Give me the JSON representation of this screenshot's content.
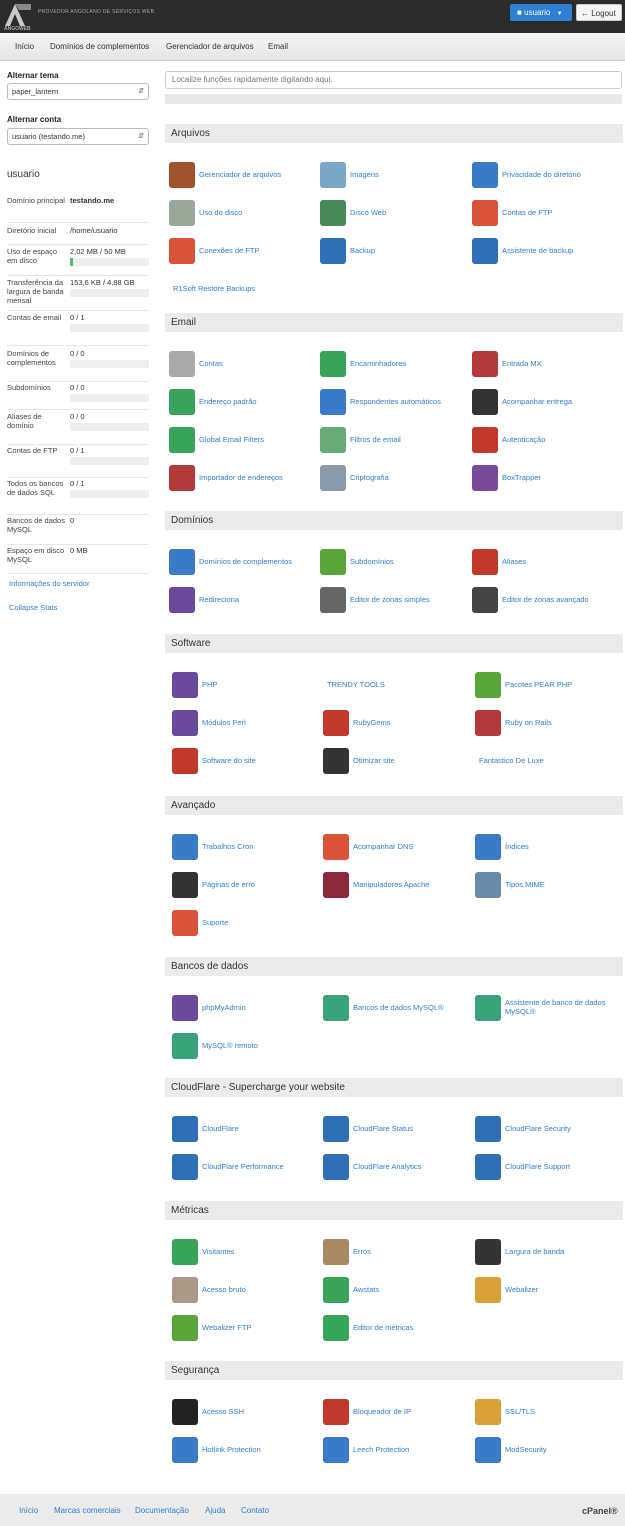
{
  "brand": {
    "logo_text": "ANGOWEB",
    "tagline": "PROVEDOR ANGOLANO DE SERVIÇOS WEB"
  },
  "topbar": {
    "user_label": "usuario",
    "logout_label": "Logout"
  },
  "nav": [
    "Início",
    "Domínios de complementos",
    "Gerenciador de arquivos",
    "Email"
  ],
  "sidebar": {
    "theme_label": "Alternar tema",
    "theme_value": "paper_lantern",
    "account_label": "Alternar conta",
    "account_value": "usuario (testando.me)",
    "username": "usuario",
    "stats": [
      {
        "label": "Domínio principal",
        "value": "testando.me"
      },
      {
        "label": "Diretório inicial",
        "value": "/home/usuario"
      },
      {
        "label": "Uso de espaço em disco",
        "value": "2,02 MB / 50 MB",
        "fill": 0.04
      },
      {
        "label": "Transferência da largura de banda mensal",
        "value": "153,6 KB / 4,88 GB",
        "fill": 0.0
      },
      {
        "label": "Contas de email",
        "value": "0 / 1",
        "fill": 0.0
      },
      {
        "label": "Domínios de complementos",
        "value": "0 / 0",
        "fill": 0.0
      },
      {
        "label": "Subdomínios",
        "value": "0 / 0",
        "fill": 0.0
      },
      {
        "label": "Aliases de domínio",
        "value": "0 / 0",
        "fill": 0.0
      },
      {
        "label": "Contas de FTP",
        "value": "0 / 1",
        "fill": 0.0
      },
      {
        "label": "Todos os bancos de dados SQL",
        "value": "0 / 1",
        "fill": 0.0
      },
      {
        "label": "Bancos de dados MySQL",
        "value": "0"
      },
      {
        "label": "Espaço em disco MySQL",
        "value": "0 MB"
      }
    ],
    "server_info": "Informações do servidor",
    "collapse": "Collapse Stats"
  },
  "search_placeholder": "Localize funções rapidamente digitando aqui.",
  "sections": [
    {
      "title": "Arquivos",
      "items": [
        {
          "label": "Gerenciador de arquivos",
          "icon": "file-manager-icon",
          "color": "#a0522d"
        },
        {
          "label": "Imagens",
          "icon": "images-icon",
          "color": "#7aa7c7"
        },
        {
          "label": "Privacidade do diretório",
          "icon": "folder-lock-icon",
          "color": "#3a7bc8"
        },
        {
          "label": "Uso do disco",
          "icon": "disk-usage-icon",
          "color": "#9aa89a"
        },
        {
          "label": "Disco Web",
          "icon": "web-disk-icon",
          "color": "#4a8a5a"
        },
        {
          "label": "Contas de FTP",
          "icon": "ftp-truck-icon",
          "color": "#d9533a"
        },
        {
          "label": "Conexões de FTP",
          "icon": "ftp-connections-icon",
          "color": "#d9533a"
        },
        {
          "label": "Backup",
          "icon": "backup-icon",
          "color": "#2f6fb5"
        },
        {
          "label": "Assistente de backup",
          "icon": "backup-wizard-icon",
          "color": "#2f6fb5"
        },
        {
          "label": "R1Soft Restore Backups",
          "icon": "",
          "color": ""
        }
      ]
    },
    {
      "title": "Email",
      "items": [
        {
          "label": "Contas",
          "icon": "email-accounts-icon",
          "color": "#aaaaaa"
        },
        {
          "label": "Encaminhadores",
          "icon": "forwarders-icon",
          "color": "#3aa35a"
        },
        {
          "label": "Entrada MX",
          "icon": "mx-entry-icon",
          "color": "#b33a3a"
        },
        {
          "label": "Endereço padrão",
          "icon": "default-address-icon",
          "color": "#3aa35a"
        },
        {
          "label": "Respondentes automáticos",
          "icon": "autoresponders-icon",
          "color": "#3a7bc8"
        },
        {
          "label": "Acompanhar entrega",
          "icon": "track-delivery-icon",
          "color": "#333333"
        },
        {
          "label": "Global Email Filters",
          "icon": "global-filters-icon",
          "color": "#3aa35a"
        },
        {
          "label": "Filtros de email",
          "icon": "email-filters-icon",
          "color": "#6aaa7a"
        },
        {
          "label": "Autenticação",
          "icon": "authentication-icon",
          "color": "#c0392b"
        },
        {
          "label": "Importador de endereços",
          "icon": "address-importer-icon",
          "color": "#b33a3a"
        },
        {
          "label": "Criptografia",
          "icon": "encryption-icon",
          "color": "#8899aa"
        },
        {
          "label": "BoxTrapper",
          "icon": "boxtrapper-icon",
          "color": "#7a4a9a"
        }
      ]
    },
    {
      "title": "Domínios",
      "items": [
        {
          "label": "Domínios de complementos",
          "icon": "addon-domains-icon",
          "color": "#3a7bc8"
        },
        {
          "label": "Subdomínios",
          "icon": "subdomains-icon",
          "color": "#5aa53a"
        },
        {
          "label": "Aliases",
          "icon": "aliases-icon",
          "color": "#c0392b"
        },
        {
          "label": "Redireciona",
          "icon": "redirects-icon",
          "color": "#6a4a9a"
        },
        {
          "label": "Editor de zonas simples",
          "icon": "dns-simple-icon",
          "color": "#666666"
        },
        {
          "label": "Editor de zonas avançado",
          "icon": "dns-advanced-icon",
          "color": "#444444"
        }
      ]
    },
    {
      "title": "Software",
      "items": [
        {
          "label": "PHP",
          "icon": "php-icon",
          "color": "#6a4a9a"
        },
        {
          "label": "TRENDY TOOLS",
          "icon": "",
          "color": ""
        },
        {
          "label": "Pacotes PEAR PHP",
          "icon": "pear-icon",
          "color": "#5aa53a"
        },
        {
          "label": "Módulos Perl",
          "icon": "perl-icon",
          "color": "#6a4a9a"
        },
        {
          "label": "RubyGems",
          "icon": "rubygems-icon",
          "color": "#c0392b"
        },
        {
          "label": "Ruby on Rails",
          "icon": "rails-icon",
          "color": "#b33a3a"
        },
        {
          "label": "Software do site",
          "icon": "site-software-icon",
          "color": "#c0392b"
        },
        {
          "label": "Otimizar site",
          "icon": "optimize-site-icon",
          "color": "#333333"
        },
        {
          "label": "Fantastico De Luxe",
          "icon": "",
          "color": ""
        }
      ]
    },
    {
      "title": "Avançado",
      "items": [
        {
          "label": "Trabalhos Cron",
          "icon": "cron-jobs-icon",
          "color": "#3a7bc8"
        },
        {
          "label": "Acompanhar DNS",
          "icon": "track-dns-icon",
          "color": "#d9533a"
        },
        {
          "label": "Índices",
          "icon": "indexes-icon",
          "color": "#3a7bc8"
        },
        {
          "label": "Páginas de erro",
          "icon": "error-pages-icon",
          "color": "#333333"
        },
        {
          "label": "Manipuladores Apache",
          "icon": "apache-handlers-icon",
          "color": "#8a2a3a"
        },
        {
          "label": "Tipos MIME",
          "icon": "mime-types-icon",
          "color": "#6a8aaa"
        },
        {
          "label": "Suporte",
          "icon": "support-icon",
          "color": "#d9533a"
        }
      ]
    },
    {
      "title": "Bancos de dados",
      "items": [
        {
          "label": "phpMyAdmin",
          "icon": "phpmyadmin-icon",
          "color": "#6a4a9a"
        },
        {
          "label": "Bancos de dados MySQL®",
          "icon": "mysql-databases-icon",
          "color": "#3aa37a"
        },
        {
          "label": "Assistente de banco de dados MySQL®",
          "icon": "mysql-wizard-icon",
          "color": "#3aa37a"
        },
        {
          "label": "MySQL® remoto",
          "icon": "remote-mysql-icon",
          "color": "#3aa37a"
        }
      ]
    },
    {
      "title": "CloudFlare - Supercharge your website",
      "items": [
        {
          "label": "CloudFlare",
          "icon": "cloudflare-icon",
          "color": "#2f6fb5"
        },
        {
          "label": "CloudFlare Status",
          "icon": "cloudflare-status-icon",
          "color": "#2f6fb5"
        },
        {
          "label": "CloudFlare Security",
          "icon": "cloudflare-security-icon",
          "color": "#2f6fb5"
        },
        {
          "label": "CloudFlare Performance",
          "icon": "cloudflare-performance-icon",
          "color": "#2f6fb5"
        },
        {
          "label": "CloudFlare Analytics",
          "icon": "cloudflare-analytics-icon",
          "color": "#2f6fb5"
        },
        {
          "label": "CloudFlare Support",
          "icon": "cloudflare-support-icon",
          "color": "#2f6fb5"
        }
      ]
    },
    {
      "title": "Métricas",
      "items": [
        {
          "label": "Visitantes",
          "icon": "visitors-icon",
          "color": "#3aa35a"
        },
        {
          "label": "Erros",
          "icon": "errors-icon",
          "color": "#aa8866"
        },
        {
          "label": "Largura de banda",
          "icon": "bandwidth-icon",
          "color": "#333333"
        },
        {
          "label": "Acesso bruto",
          "icon": "raw-access-icon",
          "color": "#aa9988"
        },
        {
          "label": "Awstats",
          "icon": "awstats-icon",
          "color": "#3aa35a"
        },
        {
          "label": "Webalizer",
          "icon": "webalizer-icon",
          "color": "#d9a03a"
        },
        {
          "label": "Webalizer FTP",
          "icon": "webalizer-ftp-icon",
          "color": "#5aa53a"
        },
        {
          "label": "Editor de métricas",
          "icon": "metrics-editor-icon",
          "color": "#3aa35a"
        }
      ]
    },
    {
      "title": "Segurança",
      "items": [
        {
          "label": "Acesso SSH",
          "icon": "ssh-icon",
          "color": "#222222"
        },
        {
          "label": "Bloqueador de IP",
          "icon": "ip-blocker-icon",
          "color": "#c0392b"
        },
        {
          "label": "SSL/TLS",
          "icon": "ssl-icon",
          "color": "#d9a03a"
        },
        {
          "label": "Hotlink Protection",
          "icon": "hotlink-icon",
          "color": "#3a7bc8"
        },
        {
          "label": "Leech Protection",
          "icon": "leech-icon",
          "color": "#3a7bc8"
        },
        {
          "label": "ModSecurity",
          "icon": "modsecurity-icon",
          "color": "#3a7bc8"
        }
      ]
    }
  ],
  "footer": {
    "links": [
      "Início",
      "Marcas comerciais",
      "Documentação",
      "Ajuda",
      "Contato"
    ],
    "brand": "cPanel®"
  }
}
